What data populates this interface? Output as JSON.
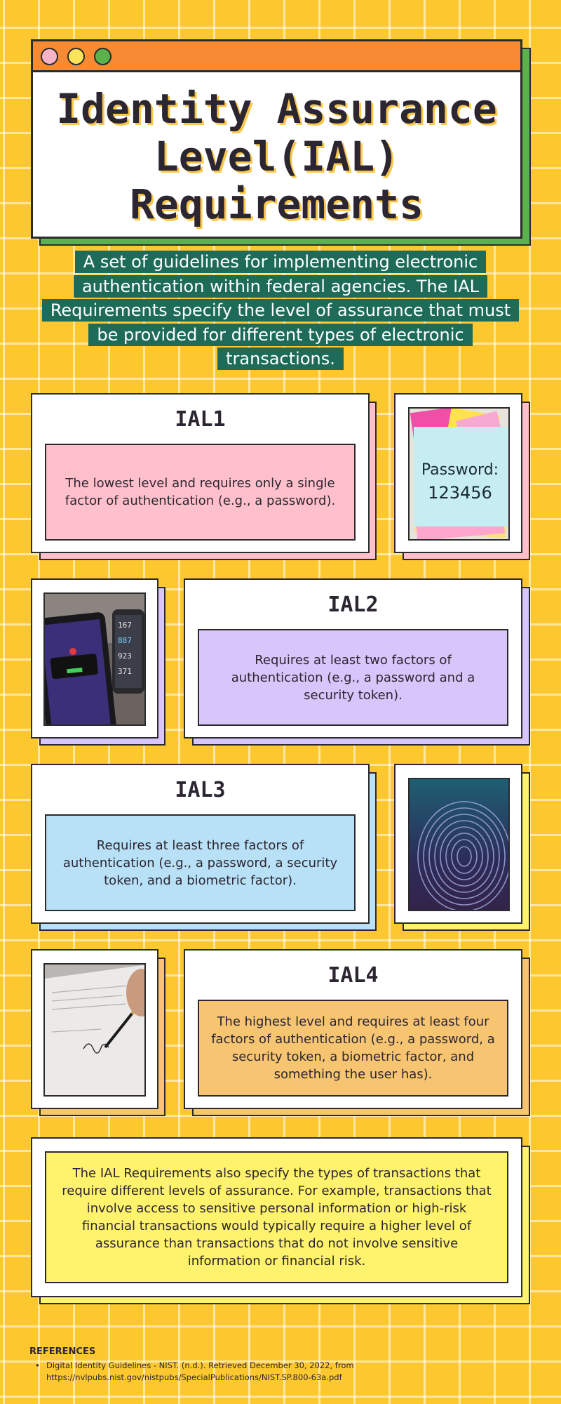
{
  "header": {
    "title": "Identity Assurance\nLevel(IAL)\nRequirements",
    "window_dots": [
      "pink",
      "yellow",
      "green"
    ]
  },
  "intro": {
    "lines": [
      "A set of guidelines for implementing electronic",
      "authentication within federal agencies. The IAL",
      "Requirements specify the level of assurance that must",
      "be provided for different types of electronic",
      "transactions."
    ]
  },
  "levels": [
    {
      "title": "IAL1",
      "text": "The lowest level and requires only a single factor of authentication (e.g., a password).",
      "accent": "#ffc0cb",
      "image": "password-sticky-note-image",
      "image_text": [
        "Password:",
        "123456"
      ]
    },
    {
      "title": "IAL2",
      "text": "Requires at least two factors of authentication (e.g., a password and a security token).",
      "accent": "#d8c5fb",
      "image": "phone-security-token-image",
      "image_text": [
        "167",
        "887",
        "923",
        "371"
      ]
    },
    {
      "title": "IAL3",
      "text": "Requires at least three factors of authentication (e.g., a password, a security token, and a biometric factor).",
      "accent": "#b8e1f7",
      "image": "fingerprint-image"
    },
    {
      "title": "IAL4",
      "text": "The highest level and requires at least four factors of authentication (e.g., a password, a security token, a biometric factor, and something the user has).",
      "accent": "#f7c572",
      "image": "signing-document-image"
    }
  ],
  "note": {
    "text": "The IAL Requirements also specify the types of transactions that require different levels of assurance. For example, transactions that involve access to sensitive personal information or high-risk financial transactions would typically require a higher level of assurance than transactions that do not involve sensitive information or financial risk.",
    "accent": "#fff36e"
  },
  "references": {
    "heading": "REFERENCES",
    "items": [
      "Digital Identity Guidelines - NIST. (n.d.). Retrieved December 30, 2022, from https://nvlpubs.nist.gov/nistpubs/SpecialPublications/NIST.SP.800-63a.pdf"
    ]
  },
  "colors": {
    "background": "#fdc82f",
    "header_bar": "#f68b33",
    "header_shadow": "#5cb24a",
    "intro_bg": "#1e6b5a",
    "ink": "#2b2631"
  }
}
